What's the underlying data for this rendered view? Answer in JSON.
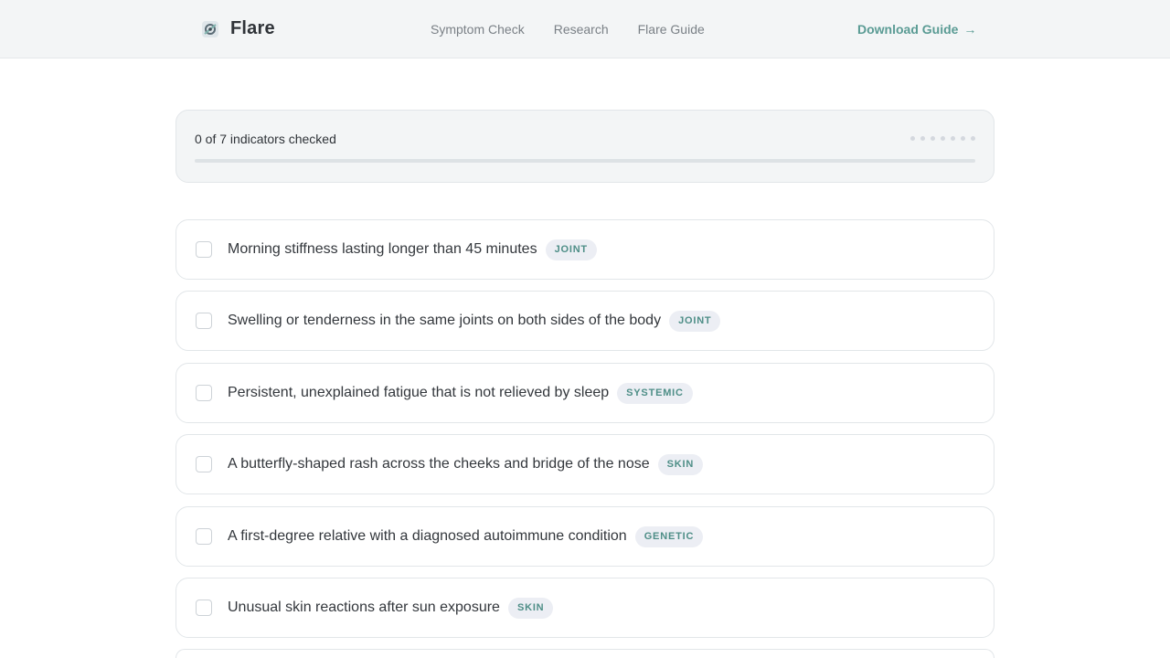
{
  "header": {
    "brand": "Flare",
    "nav": [
      "Symptom Check",
      "Research",
      "Flare Guide"
    ],
    "cta_label": "Download Guide",
    "cta_arrow": "→"
  },
  "progress": {
    "label": "0 of 7 indicators checked",
    "checked": 0,
    "total": 7,
    "fraction": 0
  },
  "checklist": [
    {
      "text": "Morning stiffness lasting longer than 45 minutes",
      "tag": "JOINT",
      "checked": false
    },
    {
      "text": "Swelling or tenderness in the same joints on both sides of the body",
      "tag": "JOINT",
      "checked": false
    },
    {
      "text": "Persistent, unexplained fatigue that is not relieved by sleep",
      "tag": "SYSTEMIC",
      "checked": false
    },
    {
      "text": "A butterfly-shaped rash across the cheeks and bridge of the nose",
      "tag": "SKIN",
      "checked": false
    },
    {
      "text": "A first-degree relative with a diagnosed autoimmune condition",
      "tag": "GENETIC",
      "checked": false
    },
    {
      "text": "Unusual skin reactions after sun exposure",
      "tag": "SKIN",
      "checked": false
    }
  ],
  "colors": {
    "accent": "#5a9b94",
    "header_bg": "#f3f5f6",
    "tag_bg": "#eceef4"
  }
}
